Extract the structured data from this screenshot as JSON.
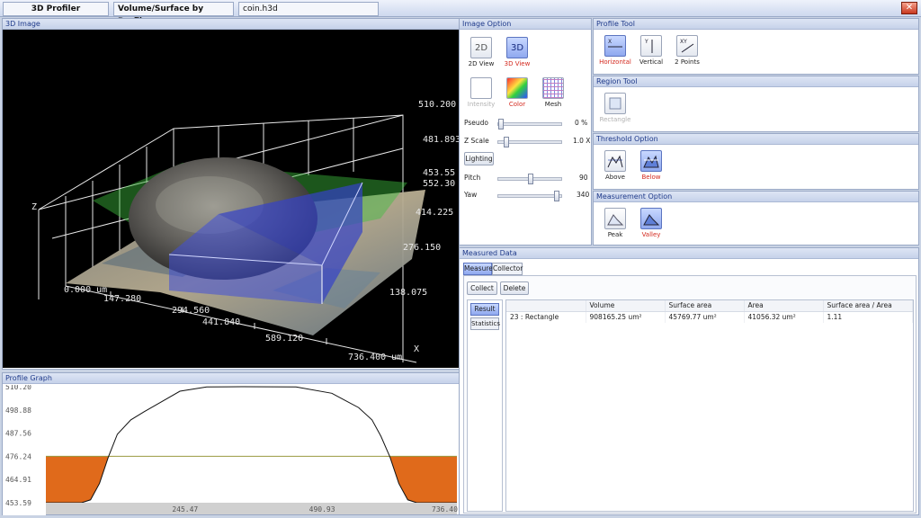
{
  "titlebar": {
    "app": "3D Profiler",
    "mode": "Volume/Surface by Profile",
    "file": "coin.h3d",
    "close": "✕"
  },
  "view3d": {
    "title": "3D Image",
    "axis_labels": {
      "z": "Z",
      "x": "X"
    },
    "z_ticks": [
      "510.200",
      "481.893",
      "453.55"
    ],
    "y_ticks": [
      "552.30",
      "414.225",
      "276.150",
      "138.075"
    ],
    "x_ticks": [
      "0.000 um",
      "147.280",
      "294.560",
      "441.840",
      "589.120",
      "736.400 um"
    ]
  },
  "image_option": {
    "title": "Image Option",
    "view_2d": {
      "icon": "2D",
      "label": "2D View"
    },
    "view_3d": {
      "icon": "3D",
      "label": "3D View"
    },
    "intensity": "Intensity",
    "color": "Color",
    "mesh": "Mesh",
    "pseudo": {
      "label": "Pseudo",
      "value": "0 %",
      "level": 0
    },
    "zscale": {
      "label": "Z Scale",
      "value": "1.0 X",
      "level": 0.08
    },
    "lighting": "Lighting",
    "pitch": {
      "label": "Pitch",
      "value": "90",
      "level": 0.5
    },
    "yaw": {
      "label": "Yaw",
      "value": "340",
      "level": 0.94
    }
  },
  "profile_tool": {
    "title": "Profile Tool",
    "horizontal": "Horizontal",
    "vertical": "Vertical",
    "two_points": "2 Points",
    "h_icon": "X",
    "v_icon": "Y",
    "xy_icon": "XY"
  },
  "region_tool": {
    "title": "Region Tool",
    "rectangle": "Rectangle"
  },
  "threshold_option": {
    "title": "Threshold Option",
    "above": "Above",
    "below": "Below"
  },
  "measurement_option": {
    "title": "Measurement Option",
    "peak": "Peak",
    "valley": "Valley"
  },
  "measured": {
    "title": "Measured Data",
    "tabs": [
      "Measure",
      "Collector"
    ],
    "collect": "Collect",
    "delete": "Delete",
    "side_tabs": [
      "Result",
      "Statistics"
    ],
    "columns": [
      "",
      "Volume",
      "Surface area",
      "Area",
      "Surface area / Area"
    ],
    "rows": [
      [
        "23 : Rectangle",
        "908165.25 um²",
        "45769.77 um²",
        "41056.32 um²",
        "1.11"
      ]
    ]
  },
  "profile_graph": {
    "title": "Profile Graph",
    "y_labels": [
      "510.20",
      "498.88",
      "487.56",
      "476.24",
      "464.91",
      "453.59"
    ],
    "x_labels": [
      "245.47",
      "490.93",
      "736.40"
    ],
    "threshold": 476.24,
    "profile_points": [
      [
        0,
        453.59
      ],
      [
        40,
        453.6
      ],
      [
        50,
        455
      ],
      [
        60,
        463
      ],
      [
        70,
        476
      ],
      [
        80,
        487
      ],
      [
        95,
        494
      ],
      [
        110,
        498
      ],
      [
        130,
        503
      ],
      [
        150,
        508
      ],
      [
        180,
        510.1
      ],
      [
        220,
        510.2
      ],
      [
        280,
        510.1
      ],
      [
        320,
        507
      ],
      [
        350,
        500
      ],
      [
        365,
        494
      ],
      [
        375,
        486
      ],
      [
        385,
        476
      ],
      [
        395,
        463
      ],
      [
        405,
        455
      ],
      [
        415,
        453.6
      ],
      [
        460,
        453.59
      ]
    ]
  }
}
